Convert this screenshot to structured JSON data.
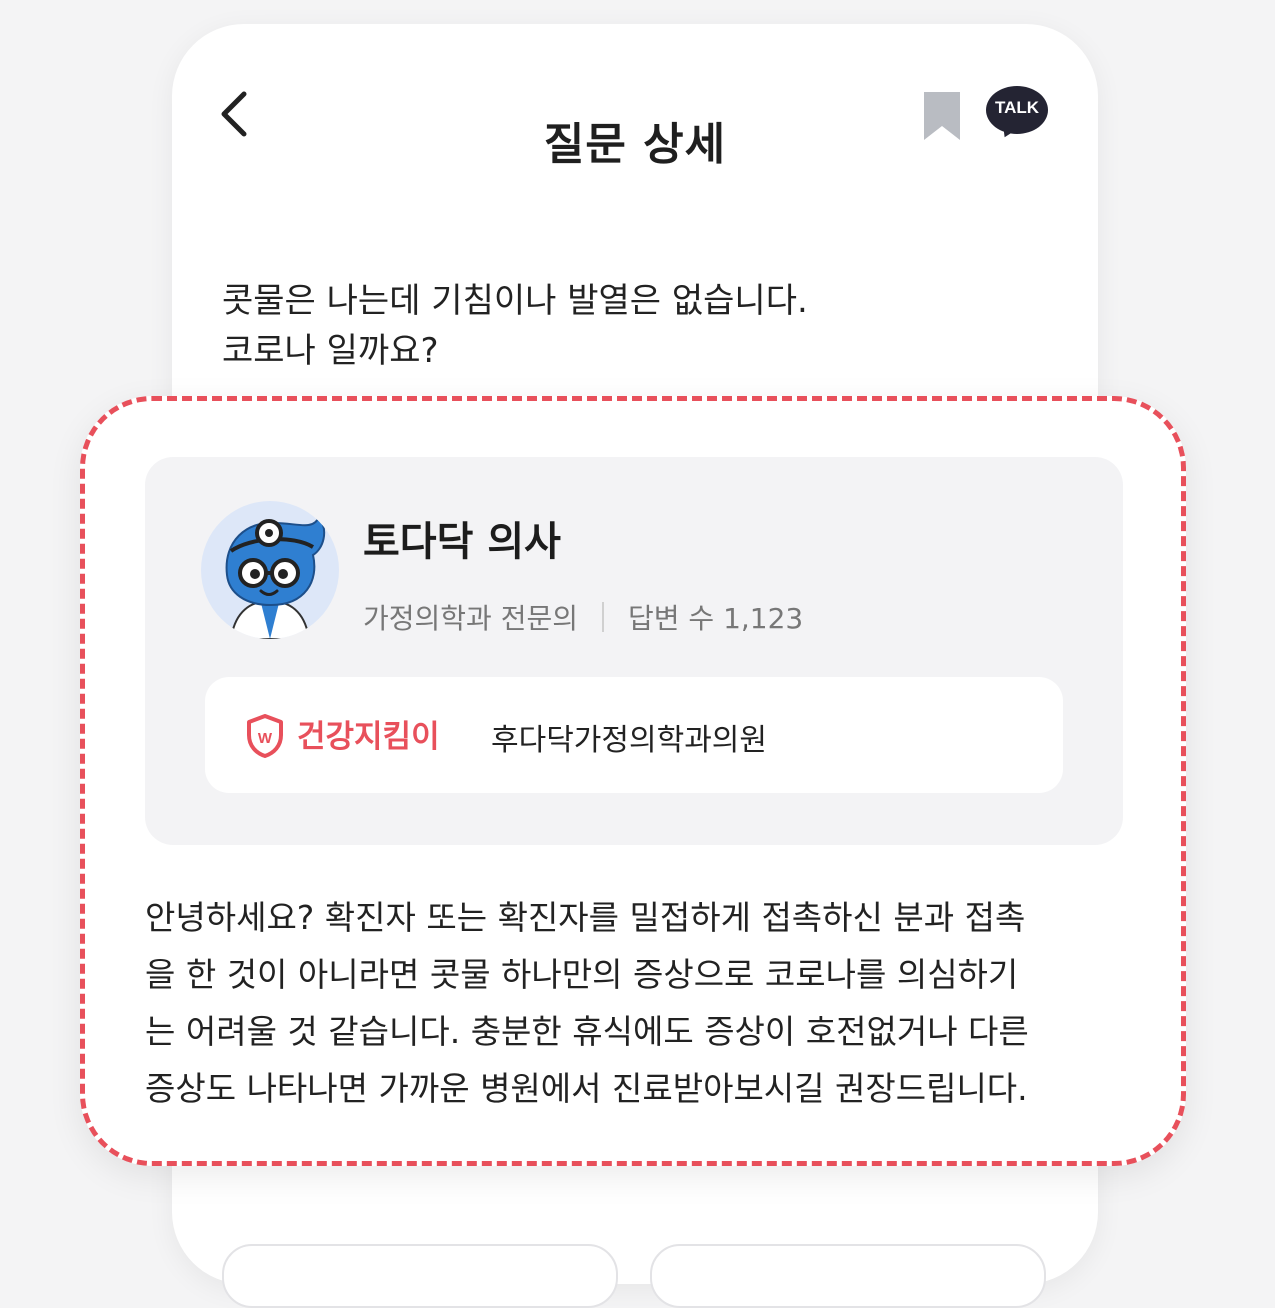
{
  "header": {
    "title": "질문 상세",
    "talk_label": "TALK"
  },
  "question": {
    "lines": [
      "콧물은 나는데 기침이나 발열은 없습니다.",
      "코로나 일까요?"
    ]
  },
  "doctor": {
    "name": "토다닥 의사",
    "specialty": "가정의학과 전문의",
    "answer_count": "답변 수 1,123",
    "badge": "건강지킴이",
    "clinic": "후다닥가정의학과의원"
  },
  "answer": {
    "lines": [
      "안녕하세요? 확진자 또는 확진자를 밀접하게 접촉하신 분과 접촉",
      "을 한 것이 아니라면 콧물 하나만의 증상으로 코로나를 의심하기",
      "는 어려울 것 같습니다. 충분한 휴식에도 증상이 호전없거나 다른",
      "증상도 나타나면 가까운 병원에서 진료받아보시길 권장드립니다."
    ]
  },
  "colors": {
    "accent": "#e8505b",
    "talk_bg": "#242433",
    "bookmark": "#b9bcc2",
    "avatar_bg": "#dde7f8",
    "character_blue": "#2f7fd1"
  },
  "icons": {
    "back": "chevron-left-icon",
    "bookmark": "bookmark-icon",
    "talk": "kakao-talk-icon",
    "badge": "shield-icon"
  }
}
